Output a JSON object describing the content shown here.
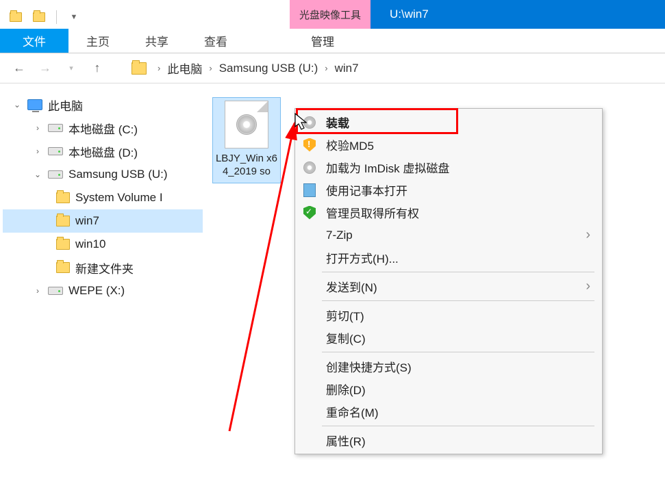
{
  "titlebar": {
    "context_tool_tab": "光盘映像工具",
    "window_title": "U:\\win7"
  },
  "ribbon": {
    "file": "文件",
    "tabs": [
      "主页",
      "共享",
      "查看"
    ],
    "context_tab": "管理"
  },
  "breadcrumb": {
    "items": [
      "此电脑",
      "Samsung USB (U:)",
      "win7"
    ]
  },
  "sidebar": {
    "root": "此电脑",
    "drives": [
      {
        "label": "本地磁盘 (C:)",
        "type": "drive"
      },
      {
        "label": "本地磁盘 (D:)",
        "type": "drive"
      },
      {
        "label": "Samsung USB (U:)",
        "type": "drive",
        "expanded": true,
        "children": [
          {
            "label": "System Volume I"
          },
          {
            "label": "win7",
            "selected": true
          },
          {
            "label": "win10"
          },
          {
            "label": "新建文件夹"
          }
        ]
      },
      {
        "label": "WEPE (X:)",
        "type": "drive"
      }
    ]
  },
  "content": {
    "file_label": "LBJY_Win x64_2019 so"
  },
  "context_menu": {
    "items": [
      {
        "label": "装载",
        "icon": "disc",
        "bold": true
      },
      {
        "label": "校验MD5",
        "icon": "shield-y"
      },
      {
        "label": "加载为 ImDisk 虚拟磁盘",
        "icon": "disc"
      },
      {
        "label": "使用记事本打开",
        "icon": "notepad"
      },
      {
        "label": "管理员取得所有权",
        "icon": "shield-g"
      },
      {
        "label": "7-Zip",
        "submenu": true
      },
      {
        "label": "打开方式(H)..."
      },
      {
        "sep": true
      },
      {
        "label": "发送到(N)",
        "submenu": true
      },
      {
        "sep": true
      },
      {
        "label": "剪切(T)"
      },
      {
        "label": "复制(C)"
      },
      {
        "sep": true
      },
      {
        "label": "创建快捷方式(S)"
      },
      {
        "label": "删除(D)"
      },
      {
        "label": "重命名(M)"
      },
      {
        "sep": true
      },
      {
        "label": "属性(R)"
      }
    ]
  }
}
